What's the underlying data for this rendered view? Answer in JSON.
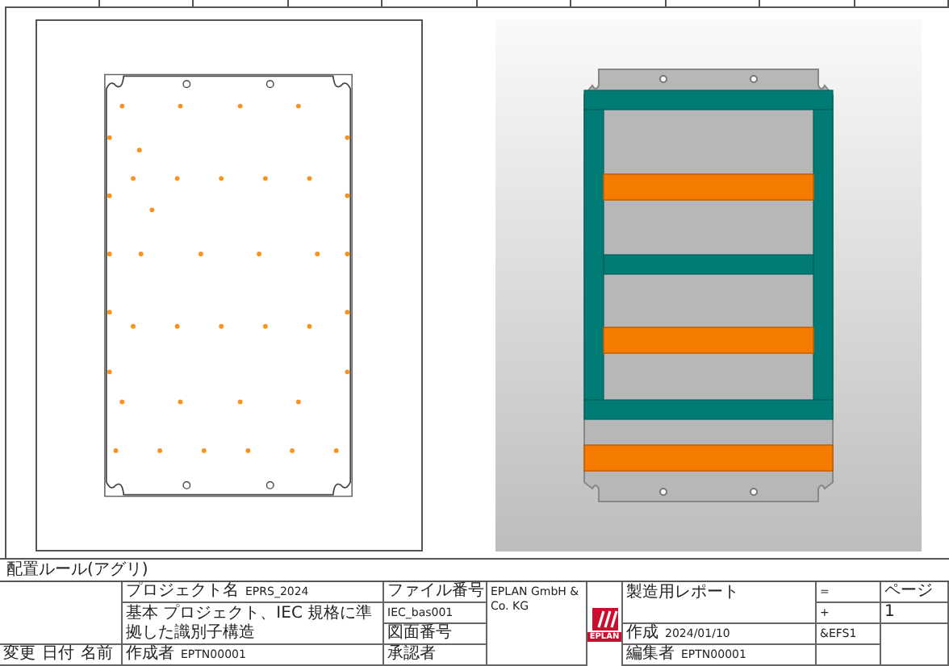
{
  "side_label": "配置ルール(アグリ)",
  "title_block": {
    "revision_labels": [
      "変更",
      "日付",
      "名前"
    ],
    "project_label": "プロジェクト名",
    "project_value": "EPRS_2024",
    "description": "基本 プロジェクト、IEC 規格に準拠した識別子構造",
    "creator_label": "作成者",
    "creator_value": "EPTN00001",
    "file_label": "ファイル番号",
    "file_value": "IEC_bas001",
    "drawing_label": "図面番号",
    "approver_label": "承認者",
    "company": "EPLAN GmbH & Co. KG",
    "logo_text": "EPLAN",
    "report_title": "製造用レポート",
    "created_label": "作成",
    "created_value": "2024/01/10",
    "editor_label": "編集者",
    "editor_value": "EPTN00001",
    "designations": [
      "=",
      "+",
      "&EFS1"
    ],
    "page_labels": [
      "ページ",
      "1"
    ]
  }
}
